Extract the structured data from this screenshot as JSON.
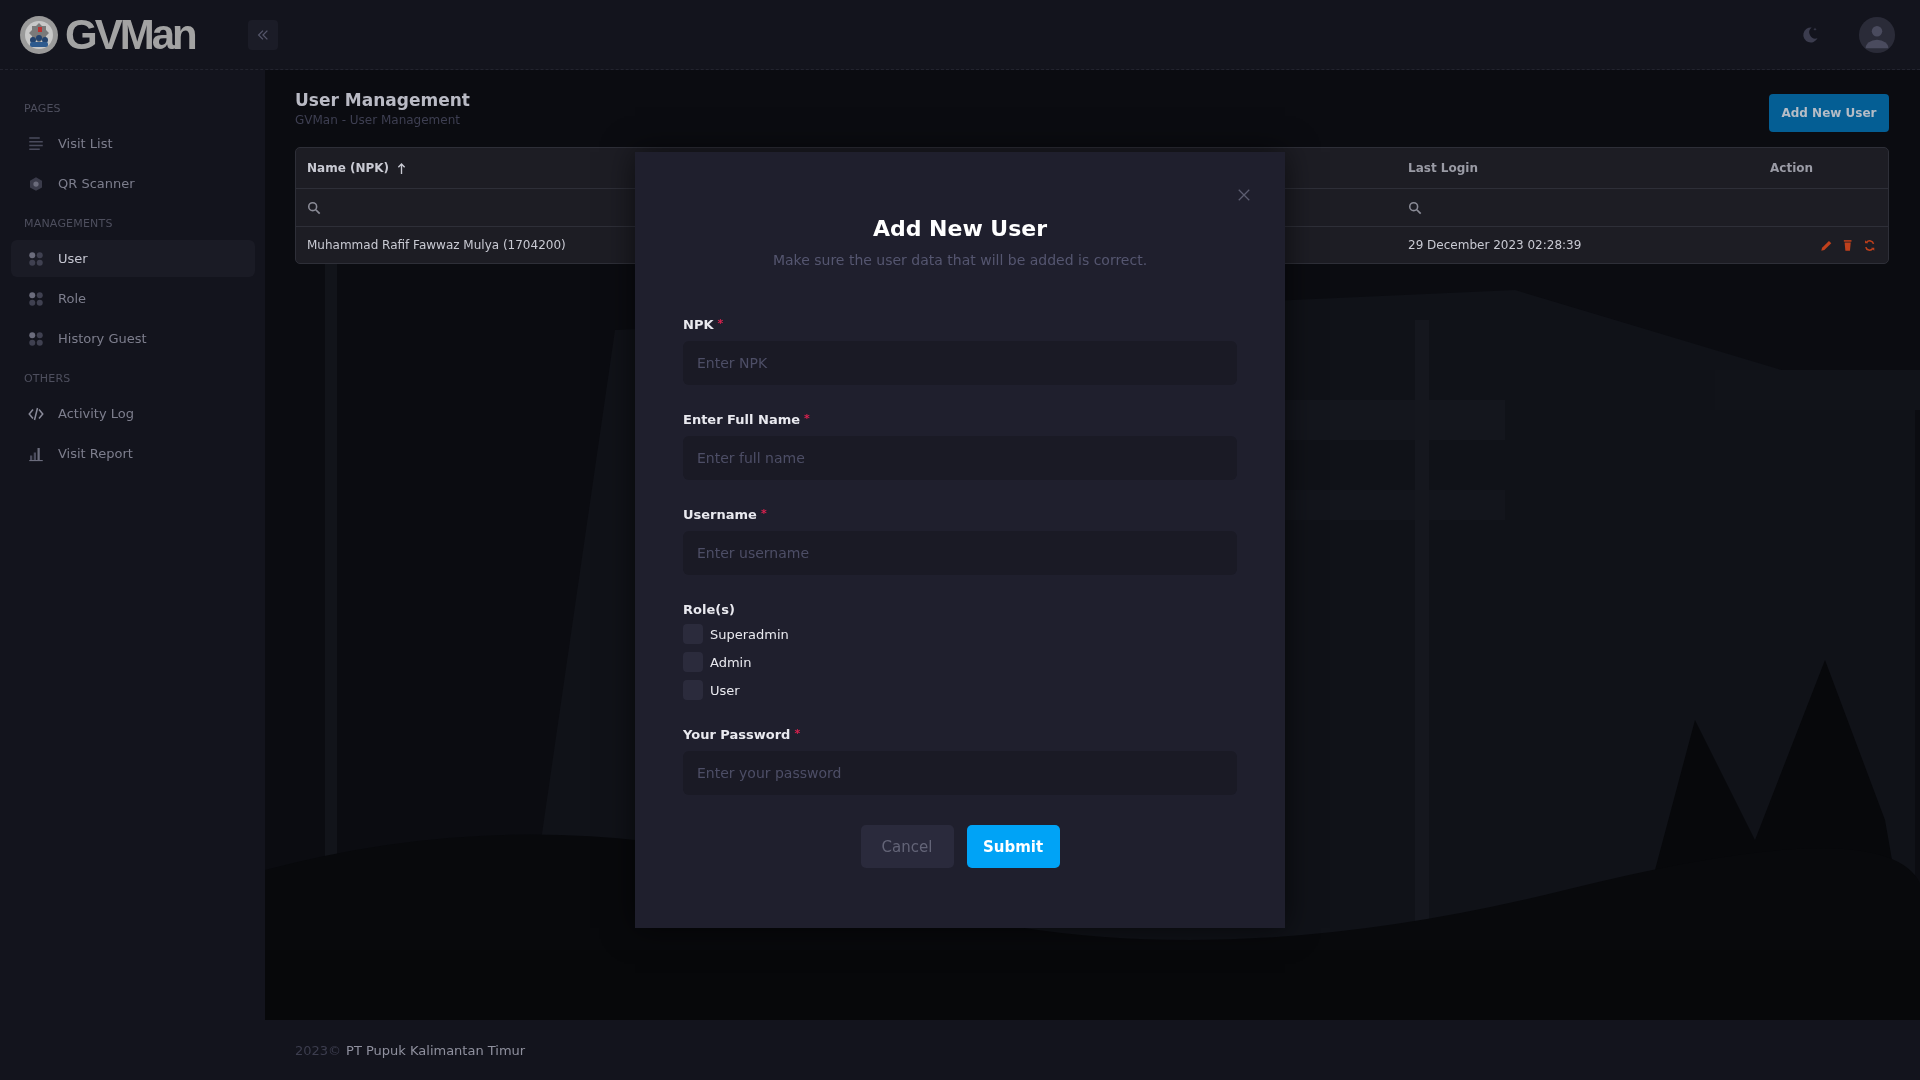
{
  "header": {
    "logo": "GVMan"
  },
  "sidebar": {
    "sections": [
      {
        "title": "PAGES",
        "items": [
          {
            "label": "Visit List",
            "selected": false
          },
          {
            "label": "QR Scanner",
            "selected": false
          }
        ]
      },
      {
        "title": "MANAGEMENTS",
        "items": [
          {
            "label": "User",
            "selected": true
          },
          {
            "label": "Role",
            "selected": false
          },
          {
            "label": "History Guest",
            "selected": false
          }
        ]
      },
      {
        "title": "OTHERS",
        "items": [
          {
            "label": "Activity Log",
            "selected": false
          },
          {
            "label": "Visit Report",
            "selected": false
          }
        ]
      }
    ]
  },
  "page": {
    "title": "User Management",
    "breadcrumb": "GVMan - User Management",
    "add_button": "Add New User"
  },
  "table": {
    "columns": [
      {
        "label": "Name (NPK)",
        "sorted": true,
        "filter": true
      },
      {
        "label": "Last Login",
        "sorted": false,
        "filter": true
      },
      {
        "label": "Action",
        "sorted": false,
        "filter": false
      }
    ],
    "rows": [
      {
        "cells": [
          "Muhammad Rafif Fawwaz Mulya (1704200)",
          "29 December 2023 02:28:39"
        ]
      }
    ]
  },
  "modal": {
    "title": "Add New User",
    "subtitle": "Make sure the user data that will be added is correct.",
    "form": [
      {
        "kind": "input",
        "label": "NPK",
        "required_mark": "*",
        "placeholder": "Enter NPK"
      },
      {
        "kind": "input",
        "label": "Enter Full Name",
        "required_mark": "*",
        "placeholder": "Enter full name"
      },
      {
        "kind": "input",
        "label": "Username",
        "required_mark": "*",
        "placeholder": "Enter username"
      },
      {
        "kind": "checkboxes",
        "label": "Role(s)",
        "options": [
          {
            "label": "Superadmin",
            "checked": false
          },
          {
            "label": "Admin",
            "checked": false
          },
          {
            "label": "User",
            "checked": false
          }
        ]
      },
      {
        "kind": "password",
        "label": "Your Password",
        "required_mark": "*",
        "placeholder": "Enter your password"
      }
    ],
    "cancel": "Cancel",
    "submit": "Submit"
  },
  "footer": {
    "year": "2023©",
    "company": "PT Pupuk Kalimantan Timur"
  }
}
